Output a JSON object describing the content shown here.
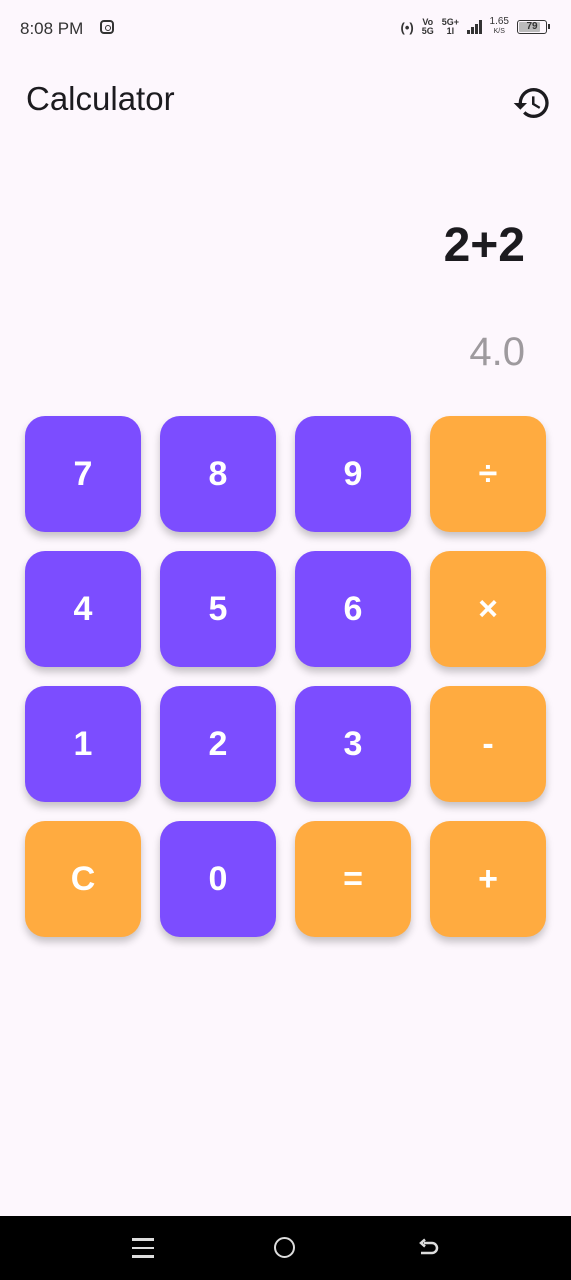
{
  "status_bar": {
    "time": "8:08 PM",
    "net_top": "Vo",
    "net_bottom": "5G",
    "net2_top": "5G+",
    "net2_bottom": "1l",
    "speed_value": "1.65",
    "speed_unit": "K/S",
    "battery": "79",
    "battery_level_pct": 79,
    "icons": [
      "instagram-icon",
      "hotspot-icon",
      "signal-icon",
      "battery-icon"
    ]
  },
  "app_bar": {
    "title": "Calculator",
    "history_icon": "history-icon"
  },
  "display": {
    "expression": "2+2",
    "result": "4.0"
  },
  "keypad": [
    {
      "label": "7",
      "kind": "num"
    },
    {
      "label": "8",
      "kind": "num"
    },
    {
      "label": "9",
      "kind": "num"
    },
    {
      "label": "÷",
      "kind": "op"
    },
    {
      "label": "4",
      "kind": "num"
    },
    {
      "label": "5",
      "kind": "num"
    },
    {
      "label": "6",
      "kind": "num"
    },
    {
      "label": "×",
      "kind": "op"
    },
    {
      "label": "1",
      "kind": "num"
    },
    {
      "label": "2",
      "kind": "num"
    },
    {
      "label": "3",
      "kind": "num"
    },
    {
      "label": "-",
      "kind": "op"
    },
    {
      "label": "C",
      "kind": "op"
    },
    {
      "label": "0",
      "kind": "num"
    },
    {
      "label": "=",
      "kind": "op"
    },
    {
      "label": "+",
      "kind": "op"
    }
  ],
  "colors": {
    "background": "#fdf7fd",
    "number_key": "#7c4dff",
    "operator_key": "#ffab40",
    "result_text": "#9e9a9e",
    "nav_bar": "#000000"
  },
  "nav_bar": {
    "icons": [
      "menu-icon",
      "home-icon",
      "back-icon"
    ]
  }
}
